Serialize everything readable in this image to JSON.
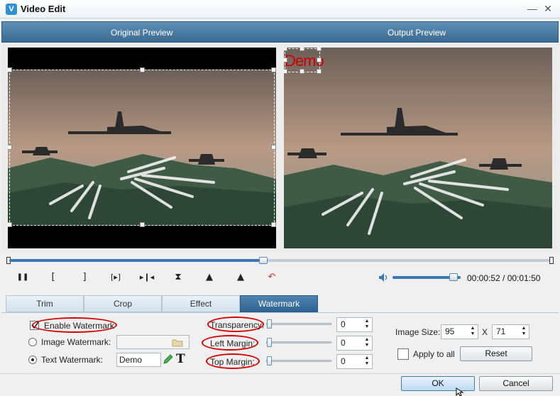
{
  "window": {
    "title": "Video Edit",
    "icon": "app-logo-icon",
    "minimize_glyph": "—",
    "close_glyph": "✕"
  },
  "preview": {
    "original_label": "Original Preview",
    "output_label": "Output Preview",
    "watermark_preview_text": "Demo"
  },
  "timeline": {
    "progress_fraction": 0.47
  },
  "controls": {
    "play_pause": "❚❚",
    "mark_in": "[",
    "mark_out": "]",
    "next_frame": "[▸]",
    "skip": "▸❙◂",
    "flip_vertical": "⧗",
    "rotate_left": "▲",
    "rotate_right": "▲",
    "undo": "↶",
    "volume_icon": "speaker-icon",
    "volume_fraction": 0.9,
    "time": "00:00:52 / 00:01:50"
  },
  "tabs": [
    {
      "label": "Trim",
      "active": false
    },
    {
      "label": "Crop",
      "active": false
    },
    {
      "label": "Effect",
      "active": false
    },
    {
      "label": "Watermark",
      "active": true
    }
  ],
  "watermark": {
    "enable_label": "Enable Watermark",
    "enable_checked": true,
    "image_label": "Image Watermark:",
    "image_value": "",
    "text_label": "Text Watermark:",
    "text_value": "Demo",
    "transparency_label": "Transparency:",
    "transparency_value": "0",
    "left_margin_label": "Left Margin:",
    "left_margin_value": "0",
    "top_margin_label": "Top  Margin:",
    "top_margin_value": "0",
    "image_size_label": "Image Size:",
    "image_width": "95",
    "size_separator": "X",
    "image_height": "71",
    "apply_all_label": "Apply to all",
    "reset_label": "Reset"
  },
  "footer": {
    "ok_label": "OK",
    "cancel_label": "Cancel"
  },
  "colors": {
    "accent": "#3a78b5",
    "highlight_ellipse": "#d40000",
    "watermark_text": "#cc0000"
  }
}
